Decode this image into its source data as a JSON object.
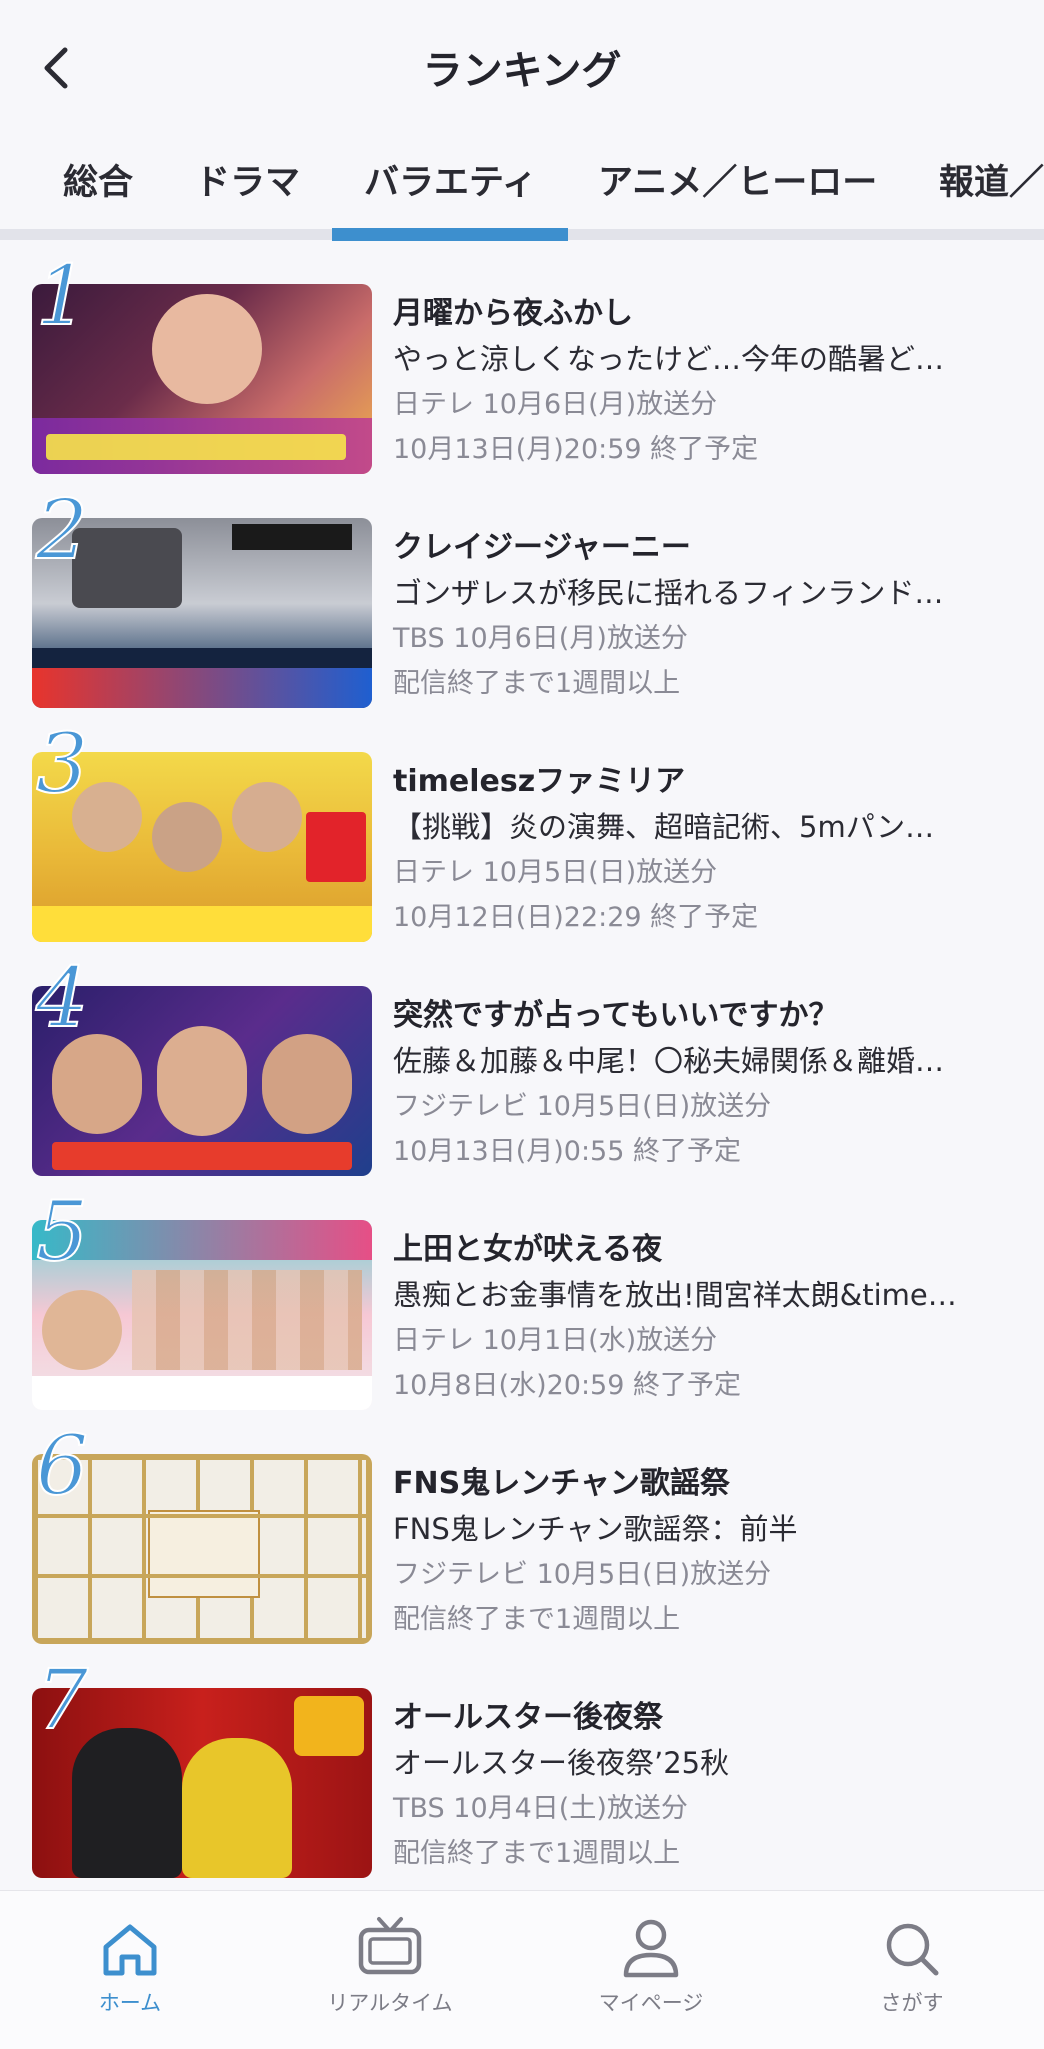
{
  "header": {
    "title": "ランキング",
    "back_icon": "chevron-left-icon"
  },
  "tabs": [
    {
      "label": "総合"
    },
    {
      "label": "ドラマ"
    },
    {
      "label": "バラエティ",
      "active": true
    },
    {
      "label": "アニメ／ヒーロー"
    },
    {
      "label": "報道／"
    }
  ],
  "accent_color": "#3d8fce",
  "items": [
    {
      "rank": "1",
      "title": "月曜から夜ふかし",
      "episode": "やっと涼しくなったけど…今年の酷暑ど…",
      "broadcast": "日テレ 10月6日(月)放送分",
      "expiry": "10月13日(月)20:59 終了予定"
    },
    {
      "rank": "2",
      "title": "クレイジージャーニー",
      "episode": "ゴンザレスが移民に揺れるフィンランド…",
      "broadcast": "TBS 10月6日(月)放送分",
      "expiry": "配信終了まで1週間以上"
    },
    {
      "rank": "3",
      "title": "timeleszファミリア",
      "episode": "【挑戦】炎の演舞、超暗記術、5mパン…",
      "broadcast": "日テレ 10月5日(日)放送分",
      "expiry": "10月12日(日)22:29 終了予定"
    },
    {
      "rank": "4",
      "title": "突然ですが占ってもいいですか？",
      "episode": "佐藤＆加藤＆中尾！〇秘夫婦関係＆離婚…",
      "broadcast": "フジテレビ 10月5日(日)放送分",
      "expiry": "10月13日(月)0:55 終了予定"
    },
    {
      "rank": "5",
      "title": "上田と女が吠える夜",
      "episode": "愚痴とお金事情を放出!間宮祥太朗&time…",
      "broadcast": "日テレ 10月1日(水)放送分",
      "expiry": "10月8日(水)20:59 終了予定"
    },
    {
      "rank": "6",
      "title": "FNS鬼レンチャン歌謡祭",
      "episode": "FNS鬼レンチャン歌謡祭：前半",
      "broadcast": "フジテレビ 10月5日(日)放送分",
      "expiry": "配信終了まで1週間以上"
    },
    {
      "rank": "7",
      "title": "オールスター後夜祭",
      "episode": "オールスター後夜祭’25秋",
      "broadcast": "TBS 10月4日(土)放送分",
      "expiry": "配信終了まで1週間以上"
    }
  ],
  "bottom_nav": [
    {
      "label": "ホーム",
      "icon": "home-icon",
      "active": true
    },
    {
      "label": "リアルタイム",
      "icon": "tv-icon"
    },
    {
      "label": "マイページ",
      "icon": "person-icon"
    },
    {
      "label": "さがす",
      "icon": "search-icon"
    }
  ]
}
